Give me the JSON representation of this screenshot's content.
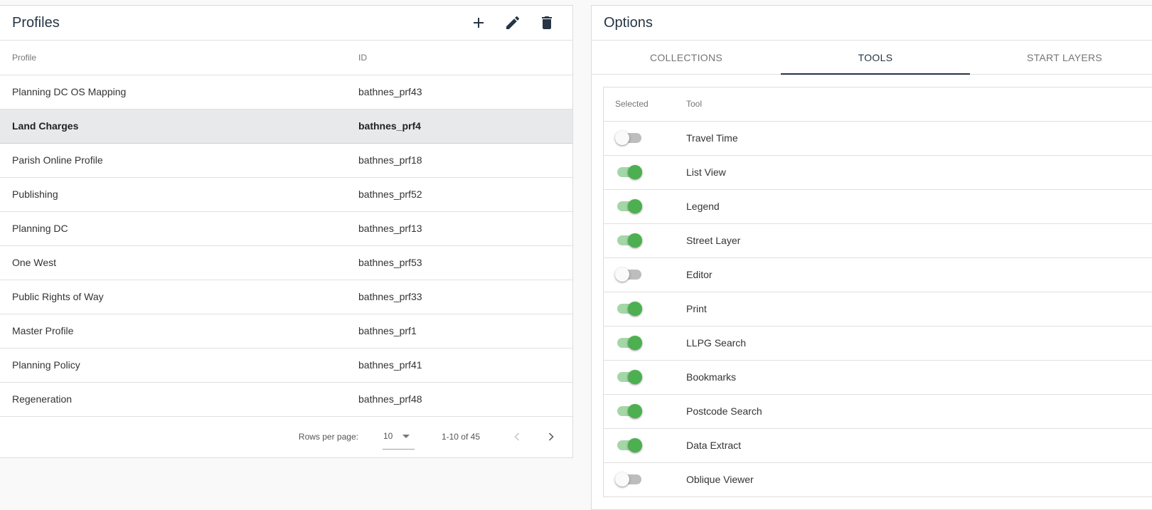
{
  "profiles": {
    "title": "Profiles",
    "actions": {
      "add": "add",
      "edit": "edit",
      "delete": "delete"
    },
    "columns": [
      "Profile",
      "ID"
    ],
    "selected_index": 1,
    "rows": [
      {
        "profile": "Planning DC OS Mapping",
        "id": "bathnes_prf43"
      },
      {
        "profile": "Land Charges",
        "id": "bathnes_prf4"
      },
      {
        "profile": "Parish Online Profile",
        "id": "bathnes_prf18"
      },
      {
        "profile": "Publishing",
        "id": "bathnes_prf52"
      },
      {
        "profile": "Planning DC",
        "id": "bathnes_prf13"
      },
      {
        "profile": "One West",
        "id": "bathnes_prf53"
      },
      {
        "profile": "Public Rights of Way",
        "id": "bathnes_prf33"
      },
      {
        "profile": "Master Profile",
        "id": "bathnes_prf1"
      },
      {
        "profile": "Planning Policy",
        "id": "bathnes_prf41"
      },
      {
        "profile": "Regeneration",
        "id": "bathnes_prf48"
      }
    ],
    "pagination": {
      "rows_per_page_label": "Rows per page:",
      "rows_per_page": "10",
      "range": "1-10 of 45",
      "prev_enabled": false,
      "next_enabled": true
    }
  },
  "options": {
    "title": "Options",
    "tabs": [
      {
        "label": "COLLECTIONS",
        "active": false
      },
      {
        "label": "TOOLS",
        "active": true
      },
      {
        "label": "START LAYERS",
        "active": false
      }
    ],
    "tools_columns": [
      "Selected",
      "Tool"
    ],
    "tools": [
      {
        "name": "Travel Time",
        "selected": false
      },
      {
        "name": "List View",
        "selected": true
      },
      {
        "name": "Legend",
        "selected": true
      },
      {
        "name": "Street Layer",
        "selected": true
      },
      {
        "name": "Editor",
        "selected": false
      },
      {
        "name": "Print",
        "selected": true
      },
      {
        "name": "LLPG Search",
        "selected": true
      },
      {
        "name": "Bookmarks",
        "selected": true
      },
      {
        "name": "Postcode Search",
        "selected": true
      },
      {
        "name": "Data Extract",
        "selected": true
      },
      {
        "name": "Oblique Viewer",
        "selected": false
      }
    ]
  },
  "colors": {
    "primary": "#263545",
    "toggle_on_thumb": "#4caf50",
    "toggle_on_track": "#a5d6a7",
    "toggle_off_track": "#bdbdbd",
    "selected_row_bg": "#e8e9eb",
    "page_bg": "#f9f9f9"
  }
}
